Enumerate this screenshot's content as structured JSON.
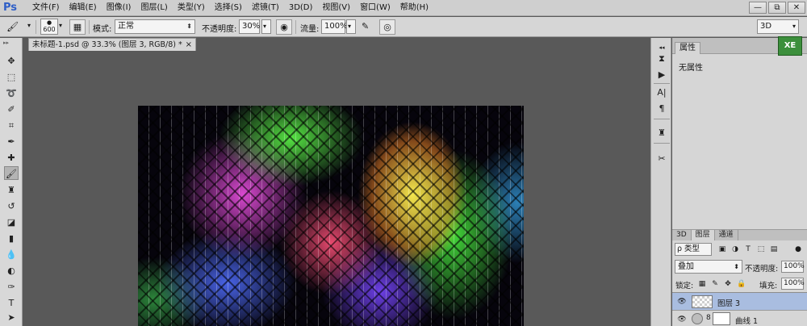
{
  "app": {
    "logo": "Ps",
    "menu": [
      "文件(F)",
      "编辑(E)",
      "图像(I)",
      "图层(L)",
      "类型(Y)",
      "选择(S)",
      "滤镜(T)",
      "3D(D)",
      "视图(V)",
      "窗口(W)",
      "帮助(H)"
    ],
    "window_controls": [
      "—",
      "⧉",
      "✕"
    ]
  },
  "options_bar": {
    "brush_size": "600",
    "mode_label": "模式:",
    "mode_value": "正常",
    "opacity_label": "不透明度:",
    "opacity_value": "30%",
    "flow_label": "流量:",
    "flow_value": "100%",
    "workspace": "3D"
  },
  "document": {
    "tab_title": "未标题-1.psd @ 33.3% (图层 3, RGB/8) *",
    "close": "×"
  },
  "properties": {
    "tab": "属性",
    "body": "无属性",
    "badge": "XE"
  },
  "layers_panel": {
    "tabs": [
      "3D",
      "图层",
      "通道"
    ],
    "filter_kind": "ρ 类型",
    "blend_mode": "叠加",
    "opacity_label": "不透明度:",
    "opacity_value": "100%",
    "lock_label": "锁定:",
    "fill_label": "填充:",
    "fill_value": "100%",
    "layers": [
      {
        "name": "图层 3",
        "selected": true
      },
      {
        "name": "曲线 1",
        "selected": false
      }
    ]
  },
  "colors": {
    "accent_selection": "#a9bde0",
    "logo_blue": "#2f5fc7",
    "workspace_bg": "#595959",
    "badge_green": "#3c8f3c"
  }
}
